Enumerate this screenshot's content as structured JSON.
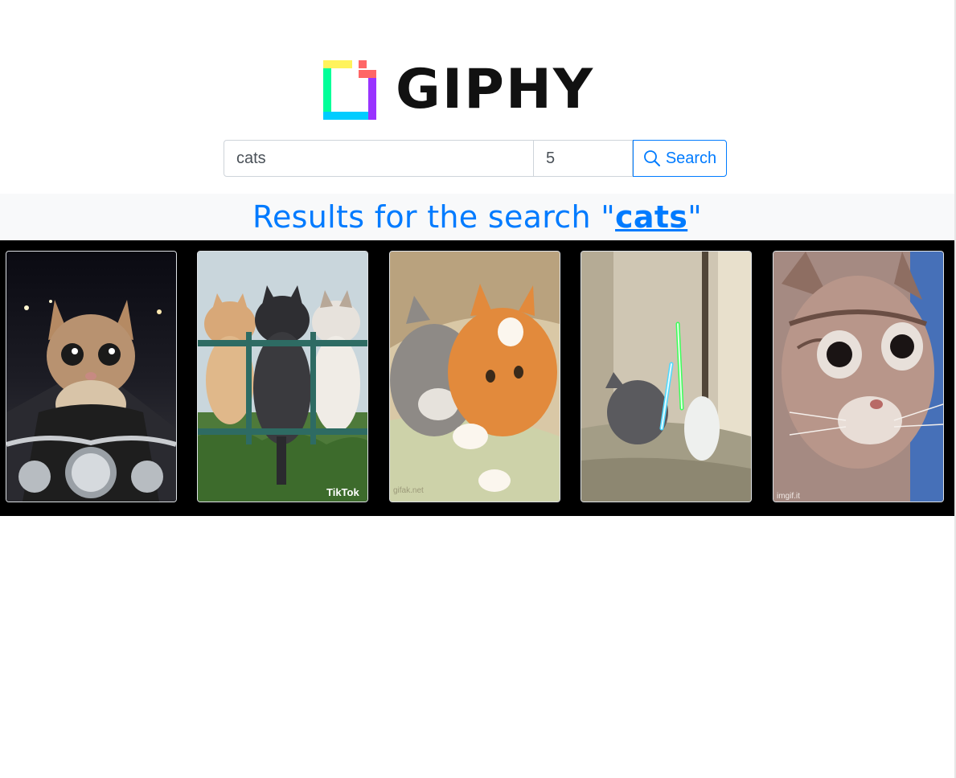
{
  "brand": {
    "name": "GIPHY",
    "colors": {
      "green": "#00ff99",
      "cyan": "#00ccff",
      "purple": "#9933ff",
      "pink": "#ff6666",
      "yellow": "#fff35c",
      "text": "#111111"
    }
  },
  "search": {
    "query": "cats",
    "limit": "5",
    "button_label": "Search",
    "button_icon": "search-icon"
  },
  "results": {
    "prefix": "Results for the search \"",
    "term": "cats",
    "suffix": "\""
  },
  "gifs": [
    {
      "name": "gif-cat-motorcycle",
      "watermark": ""
    },
    {
      "name": "gif-cats-fence",
      "watermark": "TikTok"
    },
    {
      "name": "gif-cats-cuddling",
      "watermark": "gifak.net"
    },
    {
      "name": "gif-cats-lightsaber",
      "watermark": ""
    },
    {
      "name": "gif-cat-surprised",
      "watermark": "imgif.it"
    }
  ],
  "colors": {
    "accent": "#007bff",
    "band": "#f8f9fa",
    "gallery_bg": "#000000"
  }
}
